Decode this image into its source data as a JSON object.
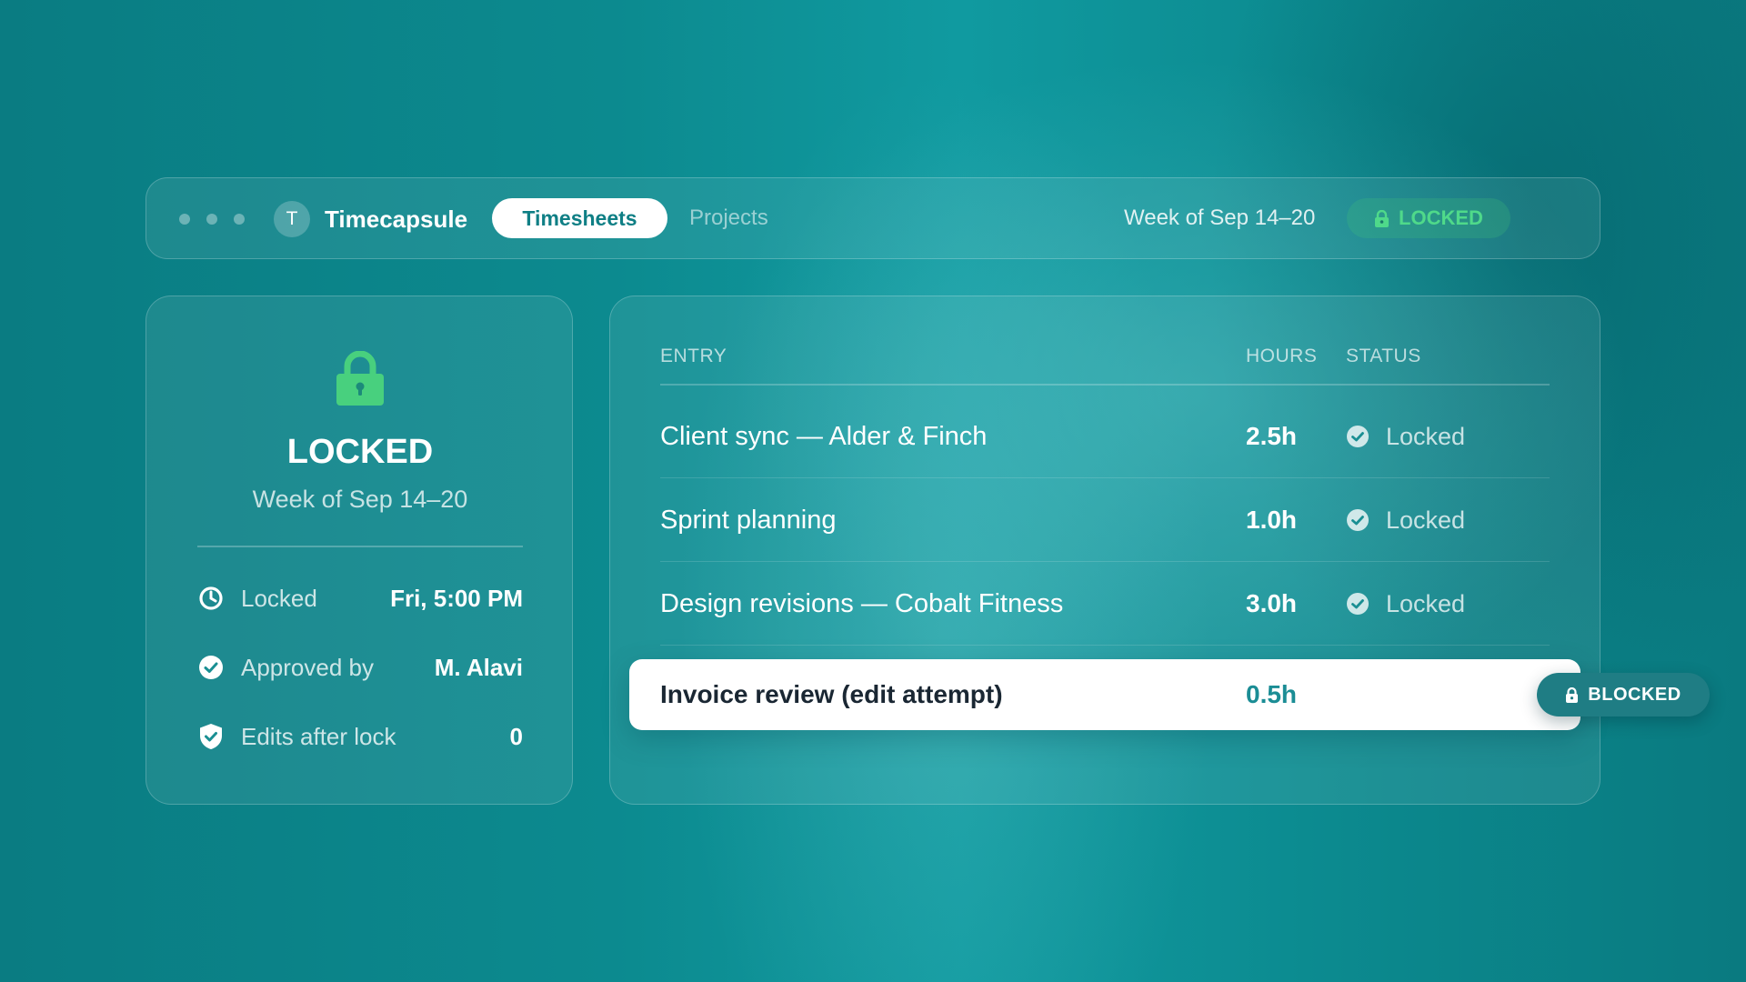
{
  "app": {
    "avatar_letter": "T",
    "name": "Timecapsule"
  },
  "nav": {
    "tabs": [
      {
        "label": "Timesheets",
        "active": true
      },
      {
        "label": "Projects",
        "active": false
      }
    ]
  },
  "header": {
    "week": "Week of Sep 14–20",
    "status_badge": "LOCKED"
  },
  "summary": {
    "icon": "lock-icon",
    "title": "LOCKED",
    "subtitle": "Week of Sep 14–20",
    "details": [
      {
        "icon": "clock-icon",
        "label": "Locked",
        "value": "Fri, 5:00 PM"
      },
      {
        "icon": "check-circle-icon",
        "label": "Approved by",
        "value": "M. Alavi"
      },
      {
        "icon": "shield-check-icon",
        "label": "Edits after lock",
        "value": "0"
      }
    ]
  },
  "table": {
    "columns": [
      "ENTRY",
      "HOURS",
      "STATUS"
    ],
    "rows": [
      {
        "entry": "Client sync — Alder & Finch",
        "hours": "2.5h",
        "status": "Locked"
      },
      {
        "entry": "Sprint planning",
        "hours": "1.0h",
        "status": "Locked"
      },
      {
        "entry": "Design revisions — Cobalt Fitness",
        "hours": "3.0h",
        "status": "Locked"
      }
    ],
    "attempt_row": {
      "entry": "Invoice review (edit attempt)",
      "hours": "0.5h",
      "badge": "BLOCKED"
    }
  },
  "colors": {
    "background": "#0c8a8f",
    "accent_green": "#4fd98a",
    "hours_teal": "#1b8d95",
    "blocked_pill": "#1f7d84"
  }
}
